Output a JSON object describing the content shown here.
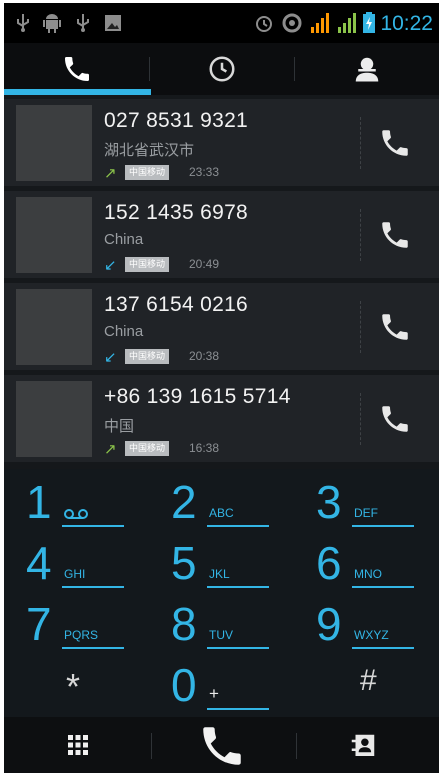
{
  "status_bar": {
    "time": "10:22",
    "icons_left": [
      "usb-icon",
      "android-debug-icon",
      "usb-icon",
      "image-notification-icon"
    ],
    "icons_right": [
      "alarm-icon",
      "sync-icon",
      "signal-orange-icon",
      "signal-green-icon",
      "battery-icon"
    ]
  },
  "tabs": [
    {
      "name": "phone-tab",
      "icon": "phone-icon",
      "selected": true
    },
    {
      "name": "recents-tab",
      "icon": "clock-icon",
      "selected": false
    },
    {
      "name": "contacts-tab",
      "icon": "person-icon",
      "selected": false
    }
  ],
  "call_log": [
    {
      "number": "027 8531 9321",
      "location": "湖北省武汉市",
      "direction": "outgoing",
      "carrier": "中国移动",
      "time": "23:33"
    },
    {
      "number": "152 1435 6978",
      "location": "China",
      "direction": "incoming",
      "carrier": "中国移动",
      "time": "20:49"
    },
    {
      "number": "137 6154 0216",
      "location": "China",
      "direction": "incoming",
      "carrier": "中国移动",
      "time": "20:38"
    },
    {
      "number": "+86 139 1615 5714",
      "location": "中国",
      "direction": "outgoing",
      "carrier": "中国移动",
      "time": "16:38"
    }
  ],
  "dialpad": {
    "keys": [
      {
        "digit": "1",
        "letters": ""
      },
      {
        "digit": "2",
        "letters": "ABC"
      },
      {
        "digit": "3",
        "letters": "DEF"
      },
      {
        "digit": "4",
        "letters": "GHI"
      },
      {
        "digit": "5",
        "letters": "JKL"
      },
      {
        "digit": "6",
        "letters": "MNO"
      },
      {
        "digit": "7",
        "letters": "PQRS"
      },
      {
        "digit": "8",
        "letters": "TUV"
      },
      {
        "digit": "9",
        "letters": "WXYZ"
      },
      {
        "digit": "*",
        "letters": ""
      },
      {
        "digit": "0",
        "letters": "+"
      },
      {
        "digit": "#",
        "letters": ""
      }
    ]
  },
  "colors": {
    "accent": "#33b5e5",
    "outgoing": "#8bc34a",
    "incoming": "#33b5e5"
  }
}
